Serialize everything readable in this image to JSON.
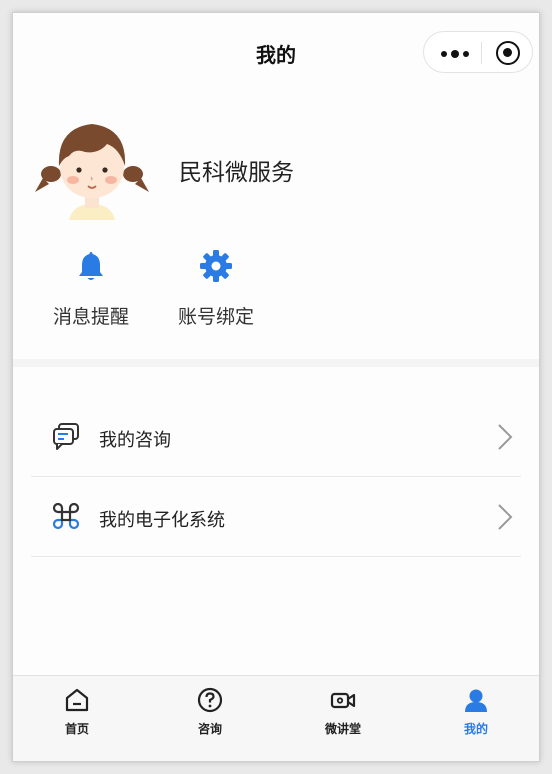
{
  "navbar": {
    "title": "我的",
    "capsule_icons": [
      "more-dots-icon",
      "close-target-icon"
    ]
  },
  "profile": {
    "name": "民科微服务",
    "avatar": "cartoon-girl-avatar"
  },
  "quick_actions": [
    {
      "label": "消息提醒",
      "icon": "bell-icon"
    },
    {
      "label": "账号绑定",
      "icon": "gear-icon"
    }
  ],
  "menu": [
    {
      "label": "我的咨询",
      "icon": "chat-bubbles-icon"
    },
    {
      "label": "我的电子化系统",
      "icon": "command-icon"
    }
  ],
  "tabs": [
    {
      "label": "首页",
      "icon": "home-icon",
      "active": false
    },
    {
      "label": "咨询",
      "icon": "question-icon",
      "active": false
    },
    {
      "label": "微讲堂",
      "icon": "video-camera-icon",
      "active": false
    },
    {
      "label": "我的",
      "icon": "user-icon",
      "active": true
    }
  ],
  "colors": {
    "accent": "#2b7be4",
    "text": "#222222",
    "divider": "#e8e8e8",
    "tabbar_bg": "#f7f7f7"
  }
}
